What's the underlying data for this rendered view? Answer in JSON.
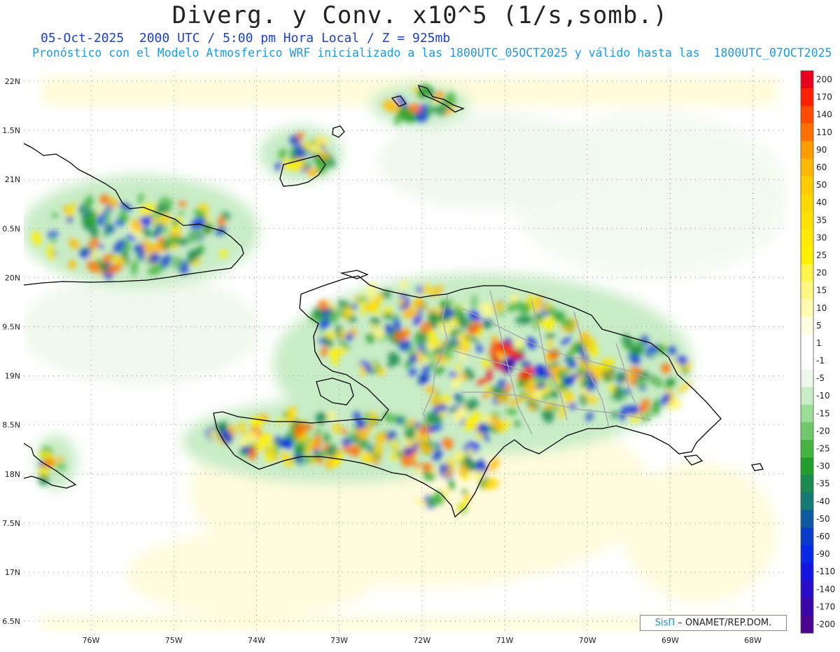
{
  "title": "Diverg. y Conv. x10^5 (1/s,somb.)",
  "subtitle_date": "05-Oct-2025  2000 UTC / 5:00 pm Hora Local / Z = 925mb",
  "subtitle_model": "Pronóstico con el Modelo Atmosferico WRF inicializado a las 1800UTC_05OCT2025 y válido hasta las  1800UTC_07OCT2025",
  "lat_labels": [
    "22N",
    "1.5N",
    "21N",
    "0.5N",
    "20N",
    "9.5N",
    "19N",
    "8.5N",
    "18N",
    "7.5N",
    "17N",
    "6.5N"
  ],
  "lon_labels": [
    "76W",
    "75W",
    "74W",
    "73W",
    "72W",
    "71W",
    "70W",
    "69W",
    "68W"
  ],
  "colorbar": {
    "labels": [
      "200",
      "170",
      "140",
      "110",
      "90",
      "60",
      "50",
      "40",
      "35",
      "30",
      "25",
      "20",
      "15",
      "10",
      "5",
      "1",
      "-1",
      "-5",
      "-10",
      "-15",
      "-20",
      "-25",
      "-30",
      "-35",
      "-40",
      "-50",
      "-60",
      "-90",
      "-110",
      "-140",
      "-170",
      "-200"
    ],
    "colors": [
      "#e8001c",
      "#ff2000",
      "#ff4a00",
      "#ff7000",
      "#ff9a00",
      "#ffb800",
      "#ffcc00",
      "#ffd800",
      "#ffe200",
      "#ffea00",
      "#fff000",
      "#fff44a",
      "#fff880",
      "#fffab0",
      "#fffde0",
      "#ffffff",
      "#ffffff",
      "#eef8ec",
      "#c8ecc6",
      "#9cdc98",
      "#70c86c",
      "#46b442",
      "#249e2a",
      "#1a8a50",
      "#137a74",
      "#0e5aa0",
      "#0a3ccc",
      "#0828e8",
      "#1414e0",
      "#2a0cc8",
      "#3a08aa",
      "#4a0690"
    ]
  },
  "credit": {
    "brand": "SisΠ",
    "text": "– ONAMET/REP.DOM."
  }
}
